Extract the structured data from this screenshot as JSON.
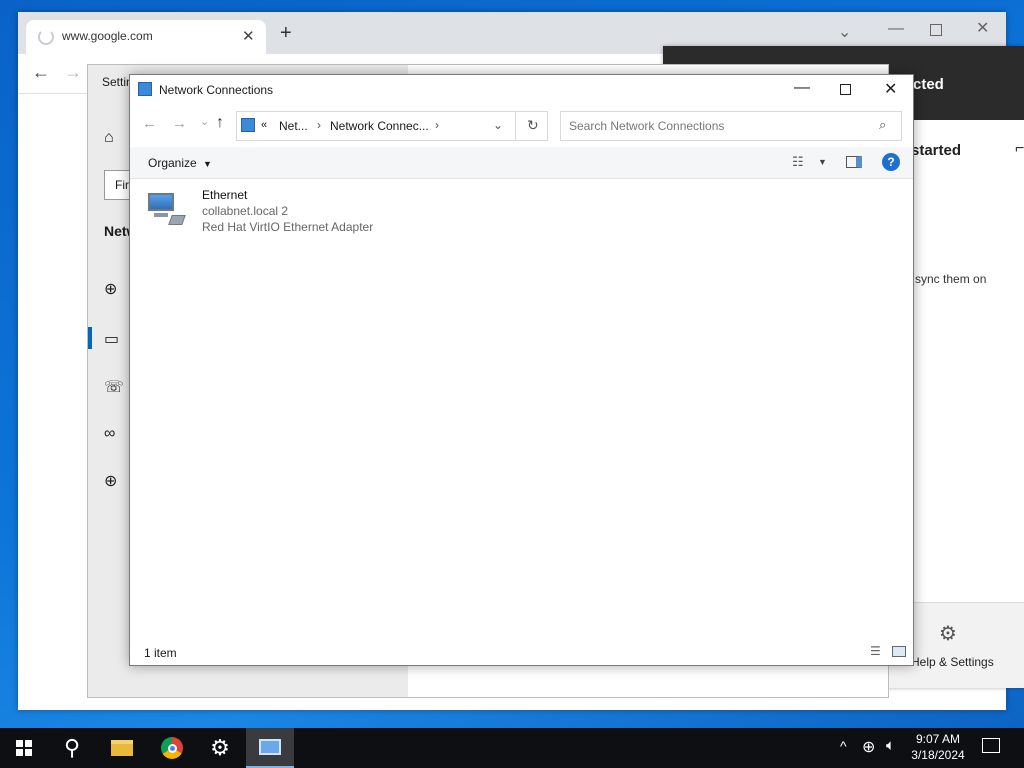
{
  "browser": {
    "tab_title": "www.google.com",
    "tab_close": "✕",
    "new_tab": "+"
  },
  "settings": {
    "title_partial": "Settin",
    "find_partial": "Fir",
    "section_partial": "Netw"
  },
  "get_started": {
    "header_partial": "cted",
    "heading_partial": "started",
    "body_partial": "sync them on",
    "help_label": "Help & Settings"
  },
  "network_connections": {
    "title": "Network Connections",
    "breadcrumb_prefix": "«",
    "breadcrumb": [
      "Net...",
      "Network Connec..."
    ],
    "search_placeholder": "Search Network Connections",
    "organize_label": "Organize",
    "items": [
      {
        "name": "Ethernet",
        "network": "collabnet.local 2",
        "adapter": "Red Hat VirtIO Ethernet Adapter"
      }
    ],
    "status": "1 item"
  },
  "taskbar": {
    "time": "9:07 AM",
    "date": "3/18/2024"
  },
  "colors": {
    "accent": "#0067c0",
    "help_blue": "#1e6fd0",
    "taskbar": "#0e0f12"
  }
}
